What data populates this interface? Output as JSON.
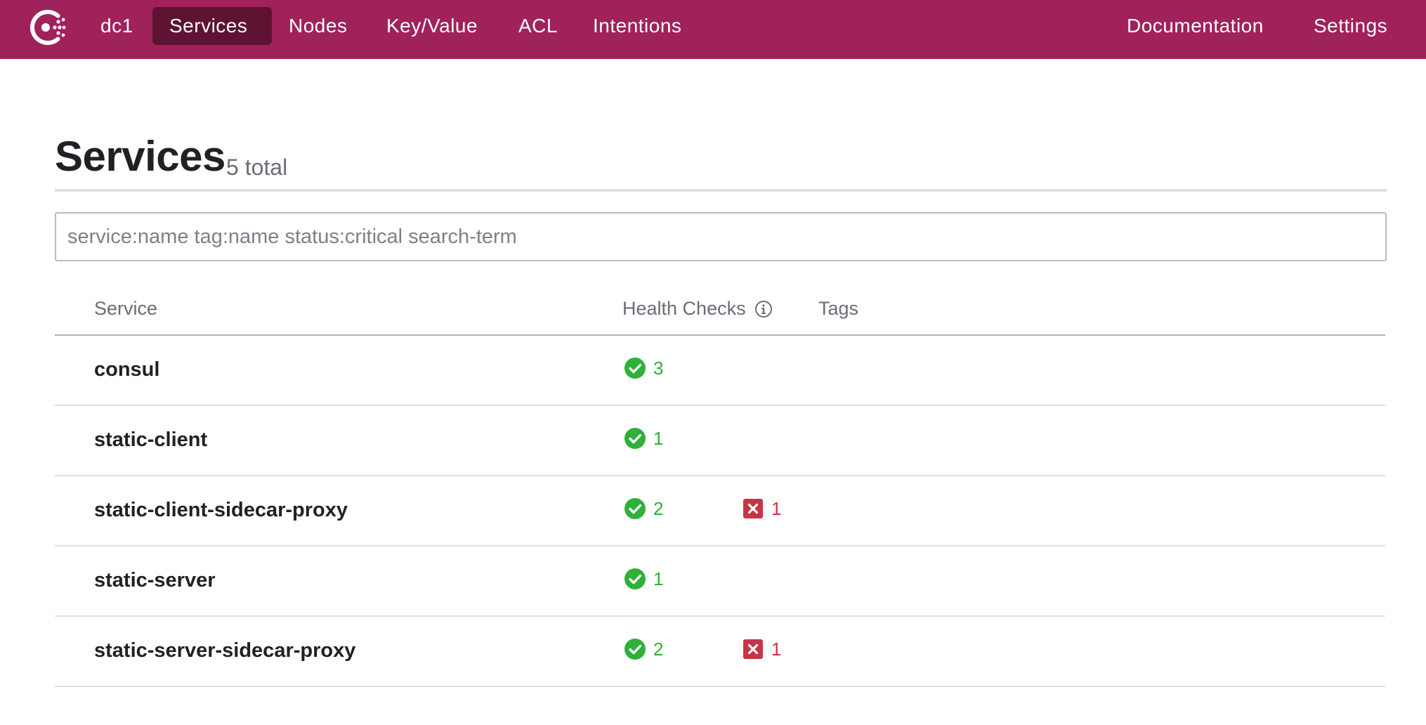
{
  "nav": {
    "logo_icon": "consul-logo-icon",
    "datacenter": "dc1",
    "items": [
      {
        "label": "Services",
        "active": true
      },
      {
        "label": "Nodes"
      },
      {
        "label": "Key/Value"
      },
      {
        "label": "ACL"
      },
      {
        "label": "Intentions"
      }
    ],
    "right": [
      {
        "label": "Documentation"
      },
      {
        "label": "Settings"
      }
    ]
  },
  "header": {
    "title": "Services",
    "count": "5 total"
  },
  "search": {
    "placeholder": "service:name tag:name status:critical search-term",
    "value": ""
  },
  "table": {
    "columns": [
      "Service",
      "Health Checks",
      "Tags"
    ],
    "info_icon": "info-icon",
    "rows": [
      {
        "name": "consul",
        "passing": "3",
        "critical": ""
      },
      {
        "name": "static-client",
        "passing": "1",
        "critical": ""
      },
      {
        "name": "static-client-sidecar-proxy",
        "passing": "2",
        "critical": "1"
      },
      {
        "name": "static-server",
        "passing": "1",
        "critical": ""
      },
      {
        "name": "static-server-sidecar-proxy",
        "passing": "2",
        "critical": "1"
      }
    ]
  },
  "colors": {
    "brand": "#a0225a",
    "brand_active": "#5e1332",
    "passing": "#2eb039",
    "critical": "#c73445"
  }
}
